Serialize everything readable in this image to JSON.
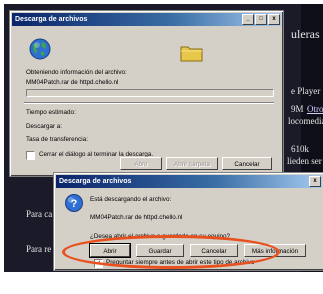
{
  "background_page": {
    "lines": [
      {
        "text": "uleras"
      },
      {
        "text": "e Player"
      },
      {
        "text": "9M"
      },
      {
        "text": "Otro"
      },
      {
        "text": "locomedia"
      },
      {
        "text": "610k"
      },
      {
        "text": "lieden ser"
      },
      {
        "text": "Para ca"
      },
      {
        "text": "Para re"
      }
    ]
  },
  "window1": {
    "title": "Descarga de archivos",
    "controls": [
      "_",
      "□",
      "x"
    ],
    "status": "Obteniendo información del archivo:",
    "file": "MM04Patch.rar de httpd.chello.nl",
    "progress": 0,
    "time_label": "Tiempo estimado:",
    "download_to_label": "Descargar a:",
    "rate_label": "Tasa de transferencia:",
    "close_checkbox_label": "Cerrar el diálogo al terminar la descarga.",
    "close_checkbox_checked": false,
    "buttons": {
      "open": "Abrir",
      "open_folder": "Abrir carpeta",
      "cancel": "Cancelar"
    }
  },
  "window2": {
    "title": "Descarga de archivos",
    "close": "x",
    "status": "Está descargando el archivo:",
    "file": "MM04Patch.rar de httpd.chello.nl",
    "question": "¿Desea abrir el archivo o guardarlo en su equipo?",
    "buttons": {
      "open": "Abrir",
      "save": "Guardar",
      "cancel": "Cancelar",
      "more": "Más información"
    },
    "always_ask_label": "Preguntar siempre antes de abrir este tipo de archivo",
    "always_ask_checked": true
  },
  "colors": {
    "highlight_ring": "#e8501e",
    "titlebar": "#0a246a"
  }
}
